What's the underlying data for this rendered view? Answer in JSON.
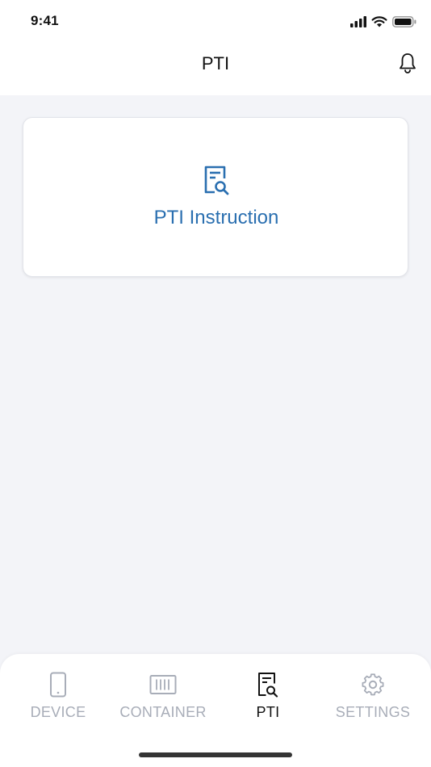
{
  "status_bar": {
    "time": "9:41"
  },
  "header": {
    "title": "PTI"
  },
  "main": {
    "card": {
      "label": "PTI Instruction"
    }
  },
  "tabbar": {
    "tabs": [
      {
        "label": "DEVICE",
        "icon": "phone-icon",
        "active": false
      },
      {
        "label": "CONTAINER",
        "icon": "container-icon",
        "active": false
      },
      {
        "label": "PTI",
        "icon": "document-search-icon",
        "active": true
      },
      {
        "label": "SETTINGS",
        "icon": "gear-icon",
        "active": false
      }
    ]
  },
  "colors": {
    "accent": "#2a6fb0",
    "inactive_tab": "#a8adb8",
    "background": "#f3f4f8"
  }
}
